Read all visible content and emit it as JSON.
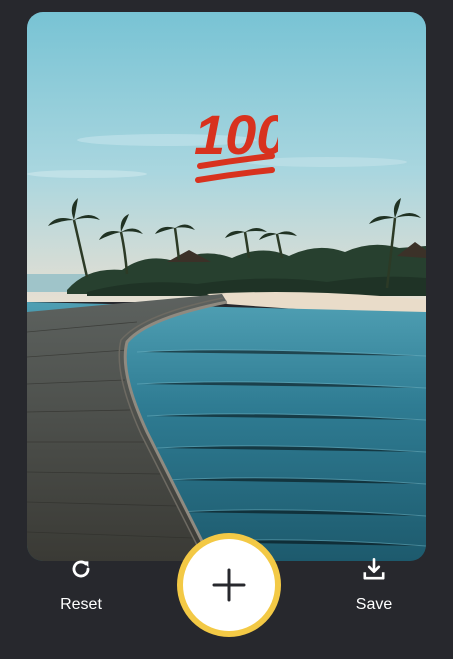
{
  "toolbar": {
    "reset_label": "Reset",
    "save_label": "Save"
  },
  "sticker": {
    "text": "100",
    "color": "#d8321e"
  },
  "colors": {
    "background": "#27282d",
    "accent_ring": "#f3c945",
    "button_fill": "#ffffff"
  },
  "icons": {
    "reset": "refresh-icon",
    "save": "download-icon",
    "add": "plus-icon"
  }
}
